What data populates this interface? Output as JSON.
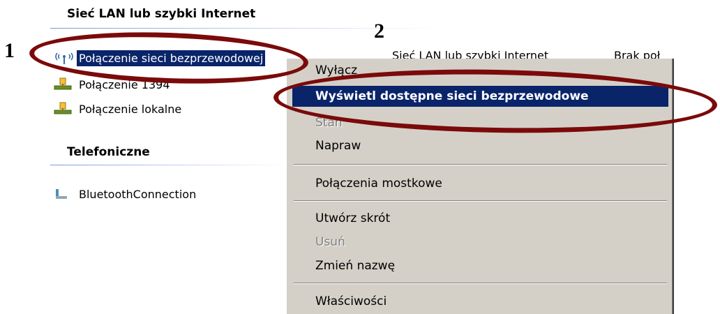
{
  "sections": {
    "lan_title": "Sieć LAN lub szybki Internet",
    "phone_title": "Telefoniczne"
  },
  "connections": [
    {
      "label": "Połączenie sieci bezprzewodowej",
      "icon": "wireless-icon",
      "selected": true
    },
    {
      "label": "Połączenie 1394",
      "icon": "network-connection-icon",
      "selected": false
    },
    {
      "label": "Połączenie lokalne",
      "icon": "network-connection-icon",
      "selected": false
    }
  ],
  "phone_connections": [
    {
      "label": "BluetoothConnection",
      "icon": "bluetooth-connection-icon"
    }
  ],
  "columns": {
    "type": "Sieć LAN lub szybki Internet",
    "status": "Brak poł"
  },
  "context_menu": {
    "items": [
      {
        "label": "Wyłącz",
        "state": "partially-hidden"
      },
      {
        "label": "Wyświetl dostępne sieci bezprzewodowe",
        "state": "default-highlighted"
      },
      {
        "label": "Stan",
        "state": "disabled"
      },
      {
        "label": "Napraw",
        "state": "normal"
      },
      {
        "label": "Połączenia mostkowe",
        "state": "normal"
      },
      {
        "label": "Utwórz skrót",
        "state": "normal"
      },
      {
        "label": "Usuń",
        "state": "disabled"
      },
      {
        "label": "Zmień nazwę",
        "state": "normal"
      },
      {
        "label": "Właściwości",
        "state": "normal"
      }
    ]
  },
  "annotations": {
    "step1": "1",
    "step2": "2"
  },
  "colors": {
    "selection": "#0a246a",
    "menu_background": "#d4d0c8",
    "annotation_ellipse": "#7b0a0a",
    "disabled_text": "#808080"
  }
}
